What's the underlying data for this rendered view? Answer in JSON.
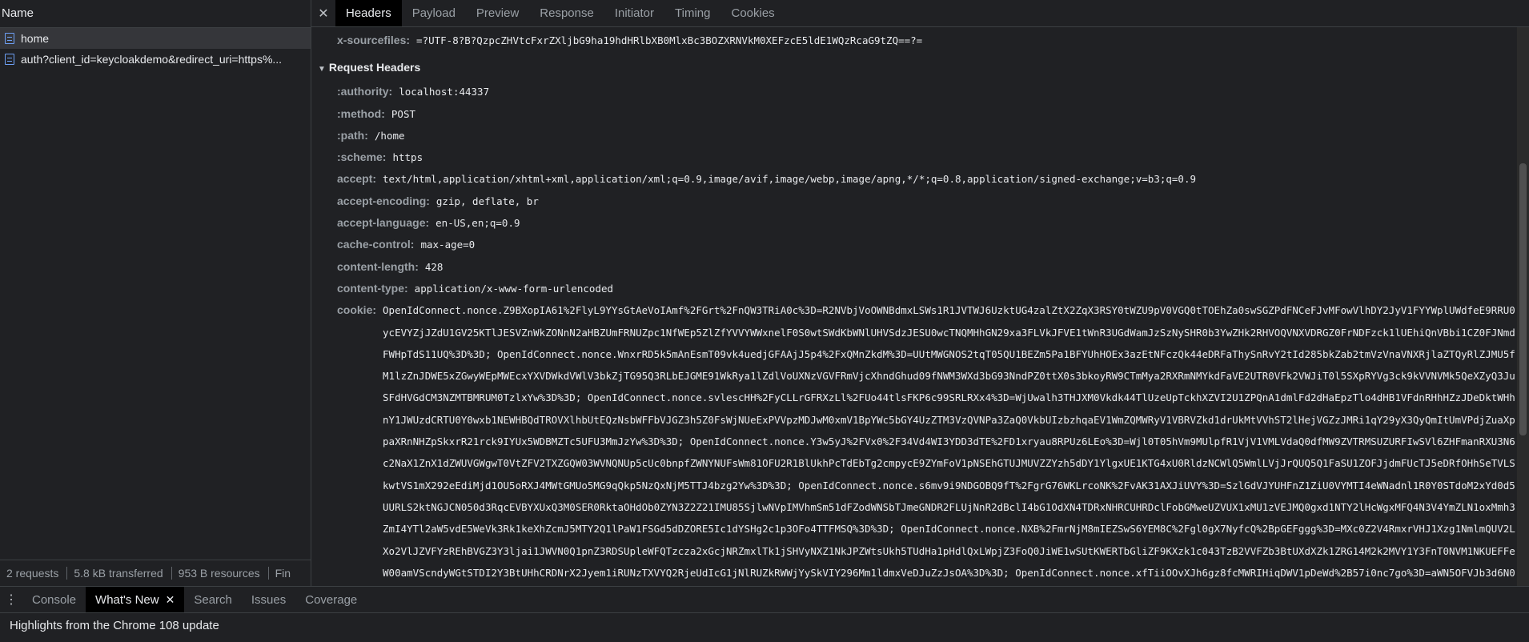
{
  "left": {
    "header": "Name",
    "requests": [
      {
        "name": "home"
      },
      {
        "name": "auth?client_id=keycloakdemo&redirect_uri=https%..."
      }
    ],
    "status": {
      "requests": "2 requests",
      "transferred": "5.8 kB transferred",
      "resources": "953 B resources",
      "finish": "Fin"
    }
  },
  "tabs": [
    "Headers",
    "Payload",
    "Preview",
    "Response",
    "Initiator",
    "Timing",
    "Cookies"
  ],
  "response_top": {
    "name": "x-sourcefiles:",
    "value": "=?UTF-8?B?QzpcZHVtcFxrZXljbG9ha19hdHRlbXB0MlxBc3BOZXRNVkM0XEFzcE5ldE1WQzRcaG9tZQ==?="
  },
  "request_section": "Request Headers",
  "request_headers": [
    {
      "name": ":authority:",
      "value": "localhost:44337"
    },
    {
      "name": ":method:",
      "value": "POST"
    },
    {
      "name": ":path:",
      "value": "/home"
    },
    {
      "name": ":scheme:",
      "value": "https"
    },
    {
      "name": "accept:",
      "value": "text/html,application/xhtml+xml,application/xml;q=0.9,image/avif,image/webp,image/apng,*/*;q=0.8,application/signed-exchange;v=b3;q=0.9"
    },
    {
      "name": "accept-encoding:",
      "value": "gzip, deflate, br"
    },
    {
      "name": "accept-language:",
      "value": "en-US,en;q=0.9"
    },
    {
      "name": "cache-control:",
      "value": "max-age=0"
    },
    {
      "name": "content-length:",
      "value": "428"
    },
    {
      "name": "content-type:",
      "value": "application/x-www-form-urlencoded"
    }
  ],
  "cookie": {
    "name": "cookie:",
    "value": "OpenIdConnect.nonce.Z9BXopIA61%2FlyL9YYsGtAeVoIAmf%2FGrt%2FnQW3TRiA0c%3D=R2NVbjVoOWNBdmxLSWs1R1JVTWJ6UzktUG4zalZtX2ZqX3RSY0tWZU9pV0VGQ0tTOEhZa0swSGZPdFNCeFJvMFowVlhDY2JyV1FYYWplUWdfeE9RRU0ycEVYZjJZdU1GV25KTlJESVZnWkZONnN2aHBZUmFRNUZpc1NfWEp5ZlZfYVVYWWxnelF0S0wtSWdKbWNlUHVSdzJESU0wcTNQMHhGN29xa3FLVkJFVE1tWnR3UGdWamJzSzNySHR0b3YwZHk2RHVOQVNXVDRGZ0FrNDFzck1lUEhiQnVBbi1CZ0FJNmdFWHpTdS11UQ%3D%3D; OpenIdConnect.nonce.WnxrRD5k5mAnEsmT09vk4uedjGFAAjJ5p4%2FxQMnZkdM%3D=UUtMWGNOS2tqT05QU1BEZm5Pa1BFYUhHOEx3azEtNFczQk44eDRFaThySnRvY2tId285bkZab2tmVzVnaVNXRjlaZTQyRlZJMU5fM1lzZnJDWE5xZGwyWEpMWEcxYXVDWkdVWlV3bkZjTG95Q3RLbEJGME91WkRya1lZdlVoUXNzVGVFRmVjcXhndGhud09fNWM3WXd3bG93NndPZ0ttX0s3bkoyRW9CTmMya2RXRmNMYkdFaVE2UTR0VFk2VWJiT0l5SXpRYVg3ck9kVVNVMk5QeXZyQ3JuSFdHVGdCM3NZMTBMRUM0TzlxYw%3D%3D; OpenIdConnect.nonce.svlescHH%2FyCLLrGFRXzLl%2FUo44tlsFKP6c99SRLRXx4%3D=WjUwalh3THJXM0Vkdk44TlUzeUpTckhXZVI2U1ZPQnA1dmlFd2dHaEpzTlo4dHB1VFdnRHhHZzJDeDktWHhnY1JWUzdCRTU0Y0wxb1NEWHBQdTROVXlhbUtEQzNsbWFFbVJGZ3h5Z0FsWjNUeExPVVpzMDJwM0xmV1BpYWc5bGY4UzZTM3VzQVNPa3ZaQ0VkbUIzbzhqaEV1WmZQMWRyV1VBRVZkd1drUkMtVVhST2lHejVGZzJMRi1qY29yX3QyQmItUmVPdjZuaXppaXRnNHZpSkxrR21rck9IYUx5WDBMZTc5UFU3MmJzYw%3D%3D; OpenIdConnect.nonce.Y3w5yJ%2FVx0%2F34Vd4WI3YDD3dTE%2FD1xryau8RPUz6LEo%3D=Wjl0T05hVm9MUlpfR1VjV1VMLVdaQ0dfMW9ZVTRMSUZURFIwSVl6ZHFmanRXU3N6c2NaX1ZnX1dZWUVGWgwT0VtZFV2TXZGQW03WVNQNUp5cUc0bnpfZWNYNUFsWm81OFU2R1BlUkhPcTdEbTg2cmpycE9ZYmFoV1pNSEhGTUJMUVZZYzh5dDY1YlgxUE1KTG4xU0RldzNCWlQ5WmlLVjJrQUQ5Q1FaSU1ZOFJjdmFUcTJ5eDRfOHhSeTVLSkwtVS1mX292eEdiMjd1OU5oRXJ4MWtGMUo5MG9qQkp5NzQxNjM5TTJ4bzg2Yw%3D%3D; OpenIdConnect.nonce.s6mv9i9NDGOBQ9fT%2FgrG76WKLrcoNK%2FvAK31AXJiUVY%3D=SzlGdVJYUHFnZ1ZiU0VYMTI4eWNadnl1R0Y0STdoM2xYd0d5UURLS2ktNGJCN050d3RqcEVBYXUxQ3M0SER0RktaOHdOb0ZYN3Z2Z21IMU85SjlwNVpIMVhmSm51dFZodWNSbTJmeGNDR2FLUjNnR2dBclI4bG1OdXN4TDRxNHRCUHRDclFobGMweUZVUX1xMU1zVEJMQ0gxd1NTY2lHcWgxMFQ4N3V4YmZLN1oxMmh3ZmI4YTl2aW5vdE5WeVk3Rk1keXhZcmJ5MTY2Q1lPaW1FSGd5dDZORE5Ic1dYSHg2c1p3OFo4TTFMSQ%3D%3D; OpenIdConnect.nonce.NXB%2FmrNjM8mIEZSwS6YEM8C%2Fgl0gX7NyfcQ%2BpGEFggg%3D=MXc0Z2V4RmxrVHJ1Xzg1NmlmQUV2LXo2VlJZVFYzREhBVGZ3Y3ljai1JWVN0Q1pnZ3RDSUpleWFQTzcza2xGcjNRZmxlTk1jSHVyNXZ1NkJPZWtsUkh5TUdHa1pHdlQxLWpjZ3FoQ0JiWE1wSUtKWERTbGliZF9KXzk1c043TzB2VVFZb3BtUXdXZk1ZRG14M2k2MVY1Y3FnT0NVM1NKUEFFeW00amVScndyWGtSTDI2Y3BtUHhCRDNrX2Jyem1iRUNzTXVYQ2RjeUdIcG1jNlRUZkRWWjYySkVIY296Mm1ldmxVeDJuZzJsOA%3D%3D; OpenIdConnect.nonce.xfTiiOOvXJh6gz8fcMWRIHiqDWV1pDeWd%2B57i0nc7go%3D=aWN5OFVJb3d6N0tzX2c1MFJiaWFtWXowNWU0dlRDaW1DQDBUS01aWW"
  },
  "drawer": {
    "tabs": [
      "Console",
      "What's New",
      "Search",
      "Issues",
      "Coverage"
    ],
    "active_index": 1,
    "body": "Highlights from the Chrome 108 update"
  }
}
